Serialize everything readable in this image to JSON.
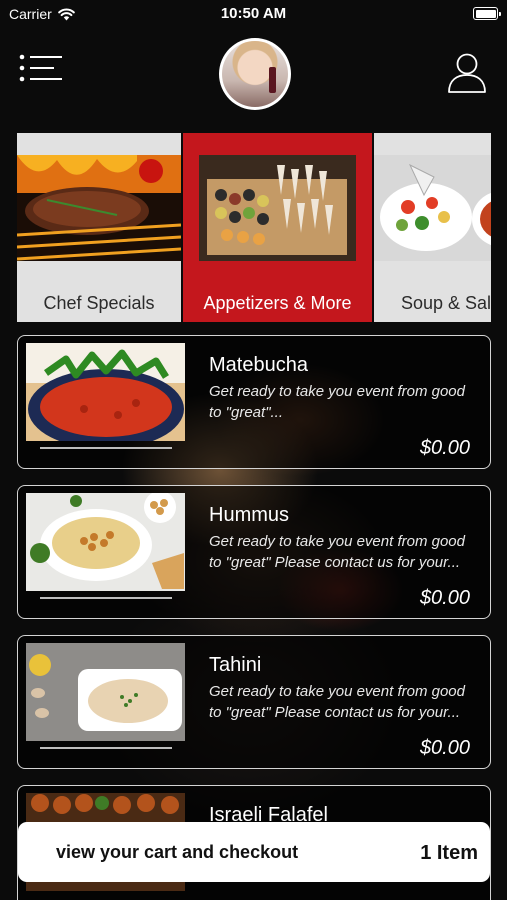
{
  "status_bar": {
    "carrier": "Carrier",
    "time": "10:50 AM"
  },
  "header": {
    "menu_icon": "menu-list-icon",
    "avatar_icon": "restaurant-avatar",
    "profile_icon": "user-profile-icon"
  },
  "categories": [
    {
      "label": "Chef Specials",
      "active": false
    },
    {
      "label": "Appetizers & More",
      "active": true
    },
    {
      "label": "Soup & Salad",
      "active": false
    }
  ],
  "items": [
    {
      "name": "Matebucha",
      "description": "Get ready to take you event from good to \"great\"...",
      "price": "$0.00"
    },
    {
      "name": "Hummus",
      "description": "Get ready to take you event from good to \"great\" Please contact us for your...",
      "price": "$0.00"
    },
    {
      "name": "Tahini",
      "description": "Get ready to take you event from good to \"great\" Please contact us for your...",
      "price": "$0.00"
    },
    {
      "name": "Israeli Falafel",
      "description": "",
      "price": ""
    }
  ],
  "cart": {
    "label": "view your cart and checkout",
    "count": "1 Item"
  },
  "colors": {
    "accent": "#c4171d",
    "category_bg": "#e1e1e1",
    "background": "#0b0b0b"
  }
}
